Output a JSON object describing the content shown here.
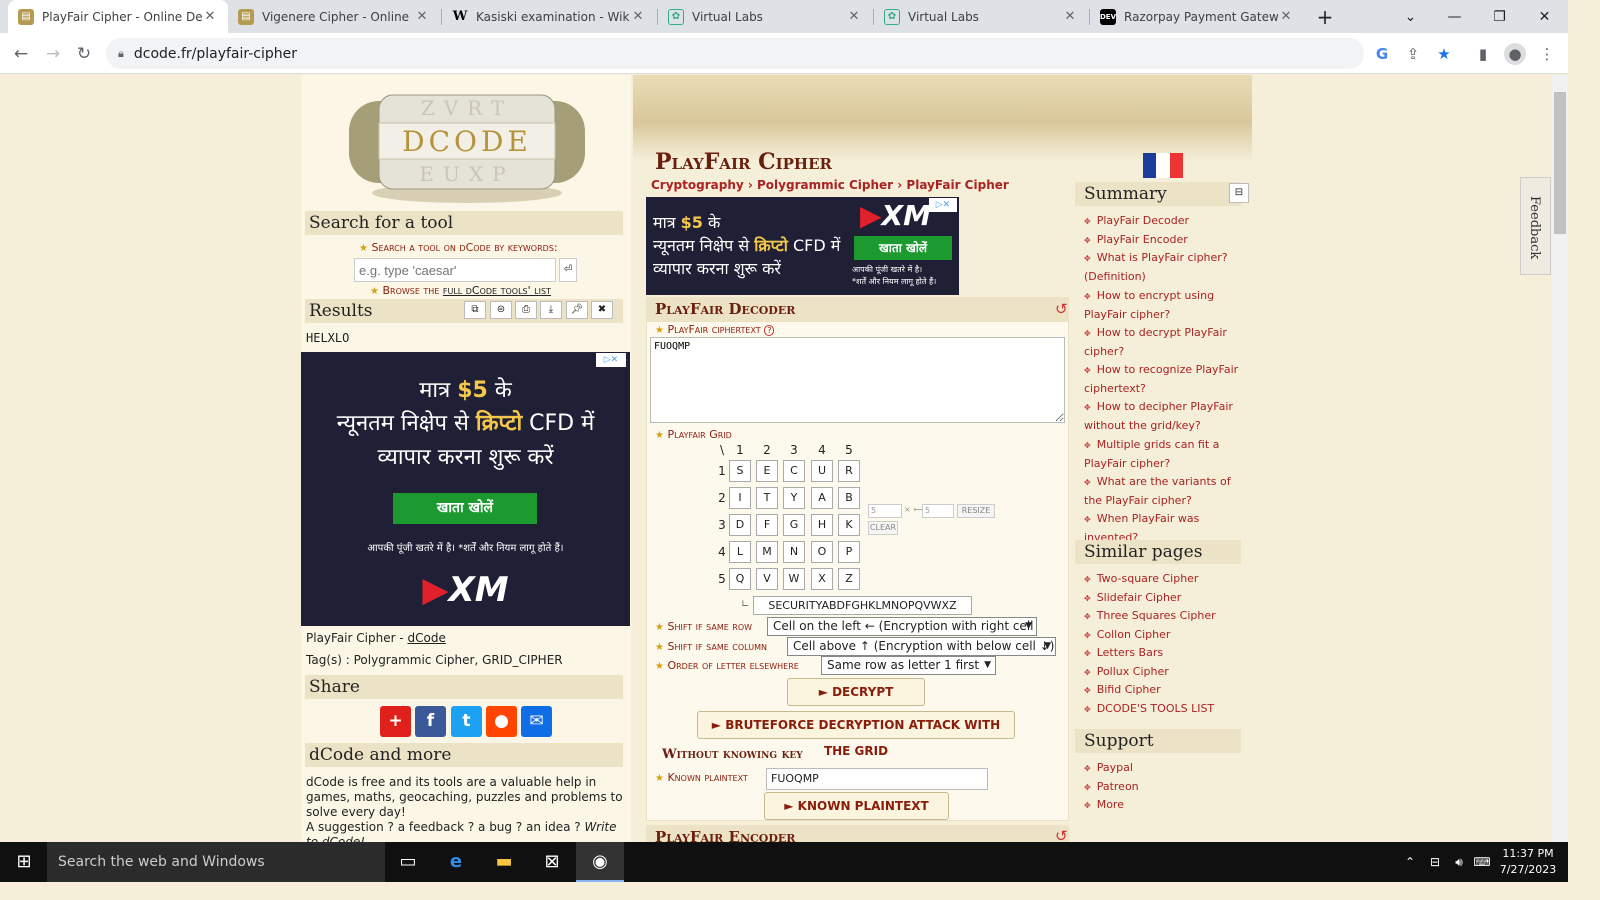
{
  "browser": {
    "tabs": [
      {
        "title": "PlayFair Cipher - Online Deco",
        "active": true
      },
      {
        "title": "Vigenere Cipher - Online Dec",
        "active": false
      },
      {
        "title": "Kasiski examination - Wikipe",
        "active": false
      },
      {
        "title": "Virtual Labs",
        "active": false
      },
      {
        "title": "Virtual Labs",
        "active": false
      },
      {
        "title": "Razorpay Payment Gateway I",
        "active": false
      }
    ],
    "url": "dcode.fr/playfair-cipher"
  },
  "left": {
    "logo_letters": "DCODE",
    "search_title": "Search for a tool",
    "search_hint": "Search a tool on dCode by keywords:",
    "search_placeholder": "e.g. type 'caesar'",
    "browse_prefix": "Browse the ",
    "browse_link": "full dCode tools' list",
    "results_title": "Results",
    "result_value": "HELXLO",
    "ad": {
      "line1_a": "मात्र ",
      "line1_b": "$5",
      "line1_c": " के",
      "line2_a": "न्यूनतम निक्षेप से ",
      "line2_b": "क्रिप्टो",
      "line2_c": " CFD में",
      "line3": "व्यापार करना शुरू करें",
      "button": "खाता खोलें",
      "note": "आपकी पूंजी खतरे में है। *शर्तें और नियम लागू होते हैं।",
      "brand": "XM"
    },
    "credit_prefix": "PlayFair Cipher - ",
    "credit_link": "dCode",
    "tags": "Tag(s) : Polygrammic Cipher, GRID_CIPHER",
    "share_title": "Share",
    "more_title": "dCode and more",
    "more_text": "dCode is free and its tools are a valuable help in games, maths, geocaching, puzzles and problems to solve every day!",
    "more_text2": "A suggestion ? a feedback ? a bug ? an idea ? ",
    "more_link": "Write to dCode!"
  },
  "main": {
    "title": "PlayFair Cipher",
    "breadcrumb": [
      "Cryptography",
      "Polygrammic Cipher",
      "PlayFair Cipher"
    ],
    "ad_top": {
      "l1_a": "मात्र ",
      "l1_b": "$5",
      "l1_c": " के",
      "l2_a": "न्यूनतम निक्षेप से ",
      "l2_b": "क्रिप्टो",
      "l2_c": " CFD में",
      "l3": "व्यापार करना शुरू करें",
      "button": "खाता खोलें",
      "note1": "आपकी पूंजी खतरे में है।",
      "note2": "*शर्तें और नियम लागू होते हैं।",
      "brand": "XM"
    },
    "decoder_title": "PlayFair Decoder",
    "ciphertext_label": "PlayFair ciphertext",
    "ciphertext_value": "FUOQMP",
    "grid_label": "Playfair Grid",
    "grid_corner": "\\",
    "grid_cols": [
      "1",
      "2",
      "3",
      "4",
      "5"
    ],
    "grid_rows": [
      [
        "S",
        "E",
        "C",
        "U",
        "R"
      ],
      [
        "I",
        "T",
        "Y",
        "A",
        "B"
      ],
      [
        "D",
        "F",
        "G",
        "H",
        "K"
      ],
      [
        "L",
        "M",
        "N",
        "O",
        "P"
      ],
      [
        "Q",
        "V",
        "W",
        "X",
        "Z"
      ]
    ],
    "grid_size_w": "5",
    "grid_size_h": "5",
    "resize_label": "RESIZE",
    "clear_label": "CLEAR",
    "grid_key": "SECURITYABDFGHKLMNOPQVWXZ",
    "shift_row_label": "Shift if same row",
    "shift_row_value": "Cell on the left ← (Encryption with right cell →)",
    "shift_col_label": "Shift if same column",
    "shift_col_value": "Cell above ↑ (Encryption with below cell ↓)",
    "order_label": "Order of letter elsewhere",
    "order_value": "Same row as letter 1 first",
    "decrypt_button": "► DECRYPT PLAYFAIR",
    "bruteforce_button": "► BRUTEFORCE DECRYPTION ATTACK WITH THE GRID",
    "nokey_title": "Without knowing key",
    "known_label": "Known plaintext",
    "known_value": "FUOQMP",
    "known_button": "► KNOWN PLAINTEXT ATTACK",
    "encoder_title": "PlayFair Encoder"
  },
  "right": {
    "summary_title": "Summary",
    "summary_links": [
      "PlayFair Decoder",
      "PlayFair Encoder",
      "What is PlayFair cipher? (Definition)",
      "How to encrypt using PlayFair cipher?",
      "How to decrypt PlayFair cipher?",
      "How to recognize PlayFair ciphertext?",
      "How to decipher PlayFair without the grid/key?",
      "Multiple grids can fit a PlayFair cipher?",
      "What are the variants of the PlayFair cipher?",
      "When PlayFair was invented?"
    ],
    "similar_title": "Similar pages",
    "similar_links": [
      "Two-square Cipher",
      "Slidefair Cipher",
      "Three Squares Cipher",
      "Collon Cipher",
      "Letters Bars",
      "Pollux Cipher",
      "Bifid Cipher",
      "DCODE'S TOOLS LIST"
    ],
    "support_title": "Support",
    "support_links": [
      "Paypal",
      "Patreon",
      "More"
    ],
    "feedback": "Feedback"
  },
  "taskbar": {
    "search_placeholder": "Search the web and Windows",
    "time": "11:37 PM",
    "date": "7/27/2023"
  },
  "colors": {
    "accent": "#8a1c0c",
    "ad_bg": "#1f2036",
    "ad_button": "#1c9a2f"
  }
}
